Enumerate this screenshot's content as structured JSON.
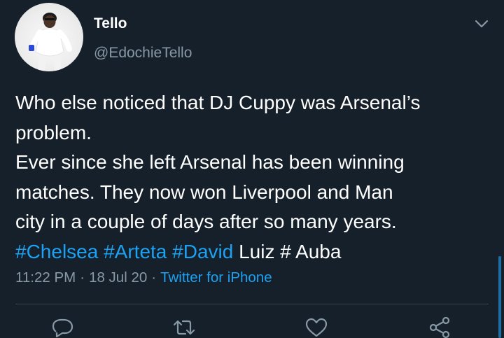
{
  "user": {
    "display_name": "Tello",
    "handle": "@EdochieTello"
  },
  "tweet": {
    "lines": [
      [
        {
          "text": "Who else noticed that DJ Cuppy was Arsenal’s",
          "type": "text"
        }
      ],
      [
        {
          "text": "problem.",
          "type": "text"
        }
      ],
      [
        {
          "text": "Ever since she left Arsenal has been winning",
          "type": "text"
        }
      ],
      [
        {
          "text": "matches. They now  won Liverpool and Man",
          "type": "text"
        }
      ],
      [
        {
          "text": "city in a couple of days after so many years.",
          "type": "text"
        }
      ],
      [
        {
          "text": "#Chelsea",
          "type": "hashtag"
        },
        {
          "text": " ",
          "type": "text"
        },
        {
          "text": "#Arteta",
          "type": "hashtag"
        },
        {
          "text": " ",
          "type": "text"
        },
        {
          "text": "#David",
          "type": "hashtag"
        },
        {
          "text": " Luiz # Auba",
          "type": "text"
        }
      ]
    ]
  },
  "meta": {
    "time": "11:22 PM",
    "date": "18 Jul 20",
    "separator": "·",
    "source": "Twitter for iPhone"
  },
  "icons": {
    "menu": "chevron-down-icon",
    "reply": "reply-icon",
    "retweet": "retweet-icon",
    "like": "heart-icon",
    "share": "share-icon"
  },
  "colors": {
    "background": "#15202b",
    "text": "#ffffff",
    "secondary": "#8899a6",
    "link": "#1da1f2",
    "divider": "#38444d"
  }
}
